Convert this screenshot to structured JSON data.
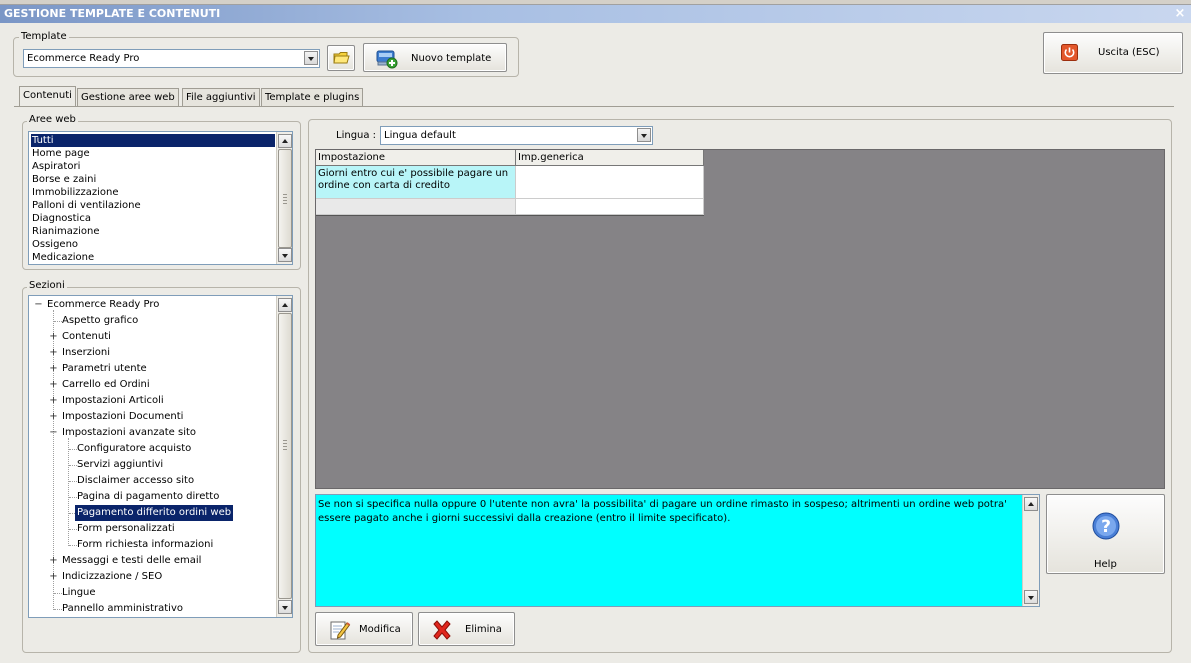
{
  "window": {
    "title": "GESTIONE TEMPLATE E CONTENUTI",
    "close_glyph": "×"
  },
  "template_group": {
    "legend": "Template",
    "combo_value": "Ecommerce Ready Pro",
    "folder_icon": "folder-icon",
    "new_template_label": "Nuovo template",
    "new_template_icon": "new-template-icon"
  },
  "exit_button": {
    "label": "Uscita (ESC)",
    "icon": "power-icon"
  },
  "tabs": [
    {
      "label": "Contenuti",
      "active": true
    },
    {
      "label": "Gestione aree web",
      "active": false
    },
    {
      "label": "File aggiuntivi",
      "active": false
    },
    {
      "label": "Template e plugins",
      "active": false
    }
  ],
  "aree_web": {
    "legend": "Aree web",
    "items": [
      "Tutti",
      "Home page",
      "Aspiratori",
      "Borse e zaini",
      "Immobilizzazione",
      "Palloni di ventilazione",
      "Diagnostica",
      "Rianimazione",
      "Ossigeno",
      "Medicazione"
    ],
    "selected_index": 0
  },
  "sezioni": {
    "legend": "Sezioni",
    "nodes": [
      {
        "label": "Ecommerce Ready Pro",
        "level": 0,
        "expander": "−"
      },
      {
        "label": "Aspetto grafico",
        "level": 1,
        "expander": ""
      },
      {
        "label": "Contenuti",
        "level": 1,
        "expander": "+"
      },
      {
        "label": "Inserzioni",
        "level": 1,
        "expander": "+"
      },
      {
        "label": "Parametri utente",
        "level": 1,
        "expander": "+"
      },
      {
        "label": "Carrello ed Ordini",
        "level": 1,
        "expander": "+"
      },
      {
        "label": "Impostazioni Articoli",
        "level": 1,
        "expander": "+"
      },
      {
        "label": "Impostazioni Documenti",
        "level": 1,
        "expander": "+"
      },
      {
        "label": "Impostazioni avanzate sito",
        "level": 1,
        "expander": "−"
      },
      {
        "label": "Configuratore acquisto",
        "level": 2,
        "expander": ""
      },
      {
        "label": "Servizi aggiuntivi",
        "level": 2,
        "expander": ""
      },
      {
        "label": "Disclaimer accesso sito",
        "level": 2,
        "expander": ""
      },
      {
        "label": "Pagina di pagamento diretto",
        "level": 2,
        "expander": ""
      },
      {
        "label": "Pagamento differito ordini web",
        "level": 2,
        "expander": "",
        "selected": true
      },
      {
        "label": "Form personalizzati",
        "level": 2,
        "expander": ""
      },
      {
        "label": "Form richiesta informazioni",
        "level": 2,
        "expander": ""
      },
      {
        "label": "Messaggi e testi delle email",
        "level": 1,
        "expander": "+"
      },
      {
        "label": "Indicizzazione / SEO",
        "level": 1,
        "expander": "+"
      },
      {
        "label": "Lingue",
        "level": 1,
        "expander": ""
      },
      {
        "label": "Pannello amministrativo",
        "level": 1,
        "expander": ""
      }
    ]
  },
  "lingua": {
    "label": "Lingua :",
    "value": "Lingua default"
  },
  "grid": {
    "headers": [
      "Impostazione",
      "Imp.generica"
    ],
    "rows": [
      {
        "setting": "Giorni entro cui e' possibile pagare un ordine con carta di credito",
        "value": ""
      }
    ],
    "highlight_color": "#b8f5f8"
  },
  "description": {
    "text": "Se non si specifica nulla oppure 0 l'utente non avra' la possibilita' di pagare un ordine rimasto in sospeso; altrimenti un ordine web potra' essere pagato anche i giorni successivi dalla creazione (entro il limite specificato).",
    "background": "#00ffff"
  },
  "help_button": {
    "label": "Help",
    "icon": "help-icon"
  },
  "actions": {
    "modifica_label": "Modifica",
    "modifica_icon": "edit-icon",
    "elimina_label": "Elimina",
    "elimina_icon": "delete-icon"
  }
}
